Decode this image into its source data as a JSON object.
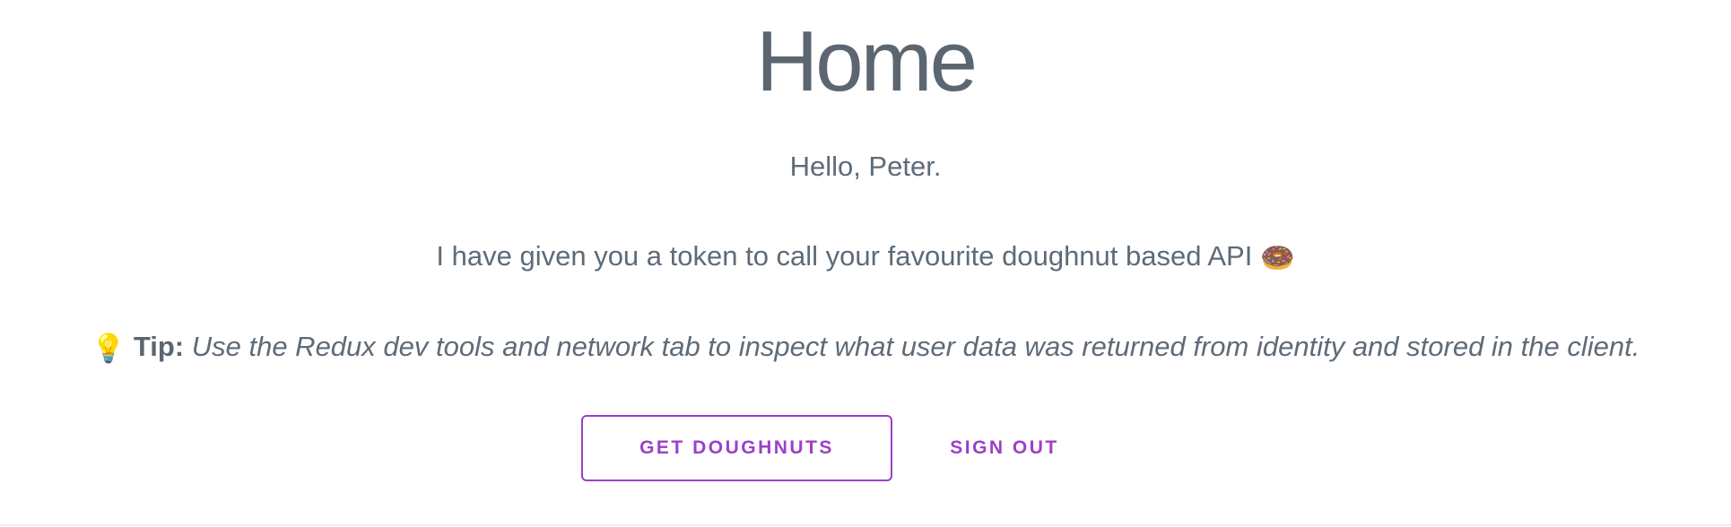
{
  "page": {
    "title": "Home",
    "greeting": "Hello, Peter.",
    "token_message": "I have given you a token to call your favourite doughnut based API",
    "token_emoji": "🍩",
    "tip": {
      "icon": "lightbulb-icon",
      "emoji": "💡",
      "label": "Tip:",
      "text": "Use the Redux dev tools and network tab to inspect what user data was returned from identity and stored in the client."
    }
  },
  "actions": {
    "get_doughnuts_label": "GET DOUGHNUTS",
    "sign_out_label": "SIGN OUT"
  },
  "colors": {
    "text": "#5e6b78",
    "accent": "#9b40c8",
    "divider": "#eeeeee"
  }
}
